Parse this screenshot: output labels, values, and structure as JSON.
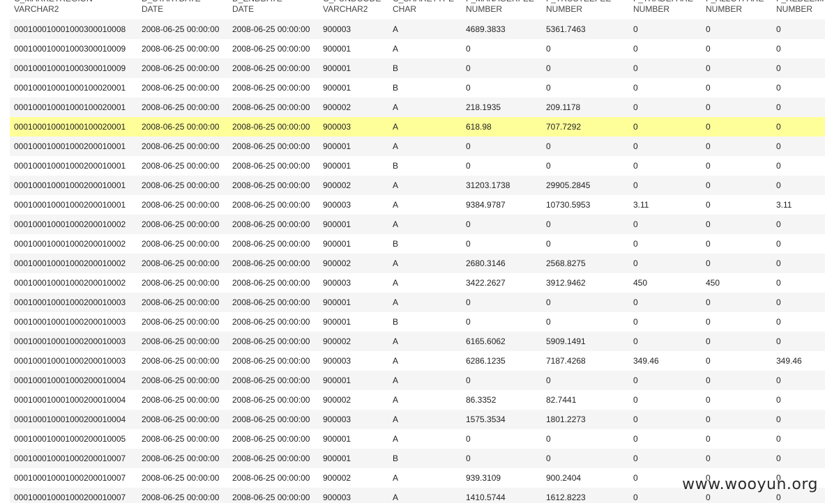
{
  "columns": [
    {
      "name": "C_MARKETREGION",
      "type": "VARCHAR2"
    },
    {
      "name": "D_STARTDATE",
      "type": "DATE"
    },
    {
      "name": "D_ENDDATE",
      "type": "DATE"
    },
    {
      "name": "C_FUNDCODE",
      "type": "VARCHAR2"
    },
    {
      "name": "C_SHARETYPE",
      "type": "CHAR"
    },
    {
      "name": "F_MANAGERFEE",
      "type": "NUMBER"
    },
    {
      "name": "F_TRUSTEEFEE",
      "type": "NUMBER"
    },
    {
      "name": "F_TRADEFARE",
      "type": "NUMBER"
    },
    {
      "name": "F_ALLOTFARE",
      "type": "NUMBER"
    },
    {
      "name": "F_REDEEMFARE",
      "type": "NUMBER"
    }
  ],
  "selected_row": 5,
  "rows": [
    [
      "00010001000100030001000​8",
      "2008-06-25 00:00:00",
      "2008-06-25 00:00:00",
      "900003",
      "A",
      "4689.3833",
      "5361.7463",
      "0",
      "0",
      "0"
    ],
    [
      "000100010001000300010009",
      "2008-06-25 00:00:00",
      "2008-06-25 00:00:00",
      "900001",
      "A",
      "0",
      "0",
      "0",
      "0",
      "0"
    ],
    [
      "000100010001000300010009",
      "2008-06-25 00:00:00",
      "2008-06-25 00:00:00",
      "900001",
      "B",
      "0",
      "0",
      "0",
      "0",
      "0"
    ],
    [
      "000100010001000100020001",
      "2008-06-25 00:00:00",
      "2008-06-25 00:00:00",
      "900001",
      "B",
      "0",
      "0",
      "0",
      "0",
      "0"
    ],
    [
      "000100010001000100020001",
      "2008-06-25 00:00:00",
      "2008-06-25 00:00:00",
      "900002",
      "A",
      "218.1935",
      "209.1178",
      "0",
      "0",
      "0"
    ],
    [
      "000100010001000100020001",
      "2008-06-25 00:00:00",
      "2008-06-25 00:00:00",
      "900003",
      "A",
      "618.98",
      "707.7292",
      "0",
      "0",
      "0"
    ],
    [
      "000100010001000200010001",
      "2008-06-25 00:00:00",
      "2008-06-25 00:00:00",
      "900001",
      "A",
      "0",
      "0",
      "0",
      "0",
      "0"
    ],
    [
      "000100010001000200010001",
      "2008-06-25 00:00:00",
      "2008-06-25 00:00:00",
      "900001",
      "B",
      "0",
      "0",
      "0",
      "0",
      "0"
    ],
    [
      "000100010001000200010001",
      "2008-06-25 00:00:00",
      "2008-06-25 00:00:00",
      "900002",
      "A",
      "31203.1738",
      "29905.2845",
      "0",
      "0",
      "0"
    ],
    [
      "000100010001000200010001",
      "2008-06-25 00:00:00",
      "2008-06-25 00:00:00",
      "900003",
      "A",
      "9384.9787",
      "10730.5953",
      "3.11",
      "0",
      "3.11"
    ],
    [
      "000100010001000200010002",
      "2008-06-25 00:00:00",
      "2008-06-25 00:00:00",
      "900001",
      "A",
      "0",
      "0",
      "0",
      "0",
      "0"
    ],
    [
      "000100010001000200010002",
      "2008-06-25 00:00:00",
      "2008-06-25 00:00:00",
      "900001",
      "B",
      "0",
      "0",
      "0",
      "0",
      "0"
    ],
    [
      "000100010001000200010002",
      "2008-06-25 00:00:00",
      "2008-06-25 00:00:00",
      "900002",
      "A",
      "2680.3146",
      "2568.8275",
      "0",
      "0",
      "0"
    ],
    [
      "000100010001000200010002",
      "2008-06-25 00:00:00",
      "2008-06-25 00:00:00",
      "900003",
      "A",
      "3422.2627",
      "3912.9462",
      "450",
      "450",
      "0"
    ],
    [
      "000100010001000200010003",
      "2008-06-25 00:00:00",
      "2008-06-25 00:00:00",
      "900001",
      "A",
      "0",
      "0",
      "0",
      "0",
      "0"
    ],
    [
      "000100010001000200010003",
      "2008-06-25 00:00:00",
      "2008-06-25 00:00:00",
      "900001",
      "B",
      "0",
      "0",
      "0",
      "0",
      "0"
    ],
    [
      "000100010001000200010003",
      "2008-06-25 00:00:00",
      "2008-06-25 00:00:00",
      "900002",
      "A",
      "6165.6062",
      "5909.1491",
      "0",
      "0",
      "0"
    ],
    [
      "000100010001000200010003",
      "2008-06-25 00:00:00",
      "2008-06-25 00:00:00",
      "900003",
      "A",
      "6286.1235",
      "7187.4268",
      "349.46",
      "0",
      "349.46"
    ],
    [
      "000100010001000200010004",
      "2008-06-25 00:00:00",
      "2008-06-25 00:00:00",
      "900001",
      "A",
      "0",
      "0",
      "0",
      "0",
      "0"
    ],
    [
      "000100010001000200010004",
      "2008-06-25 00:00:00",
      "2008-06-25 00:00:00",
      "900002",
      "A",
      "86.3352",
      "82.7441",
      "0",
      "0",
      "0"
    ],
    [
      "000100010001000200010004",
      "2008-06-25 00:00:00",
      "2008-06-25 00:00:00",
      "900003",
      "A",
      "1575.3534",
      "1801.2273",
      "0",
      "0",
      "0"
    ],
    [
      "000100010001000200010005",
      "2008-06-25 00:00:00",
      "2008-06-25 00:00:00",
      "900001",
      "A",
      "0",
      "0",
      "0",
      "0",
      "0"
    ],
    [
      "000100010001000200010007",
      "2008-06-25 00:00:00",
      "2008-06-25 00:00:00",
      "900001",
      "B",
      "0",
      "0",
      "0",
      "0",
      "0"
    ],
    [
      "000100010001000200010007",
      "2008-06-25 00:00:00",
      "2008-06-25 00:00:00",
      "900002",
      "A",
      "939.3109",
      "900.2404",
      "0",
      "0",
      "0"
    ],
    [
      "000100010001000200010007",
      "2008-06-25 00:00:00",
      "2008-06-25 00:00:00",
      "900003",
      "A",
      "1410.5744",
      "1612.8223",
      "0",
      "0",
      "0"
    ]
  ],
  "watermark": "www.wooyun.org"
}
